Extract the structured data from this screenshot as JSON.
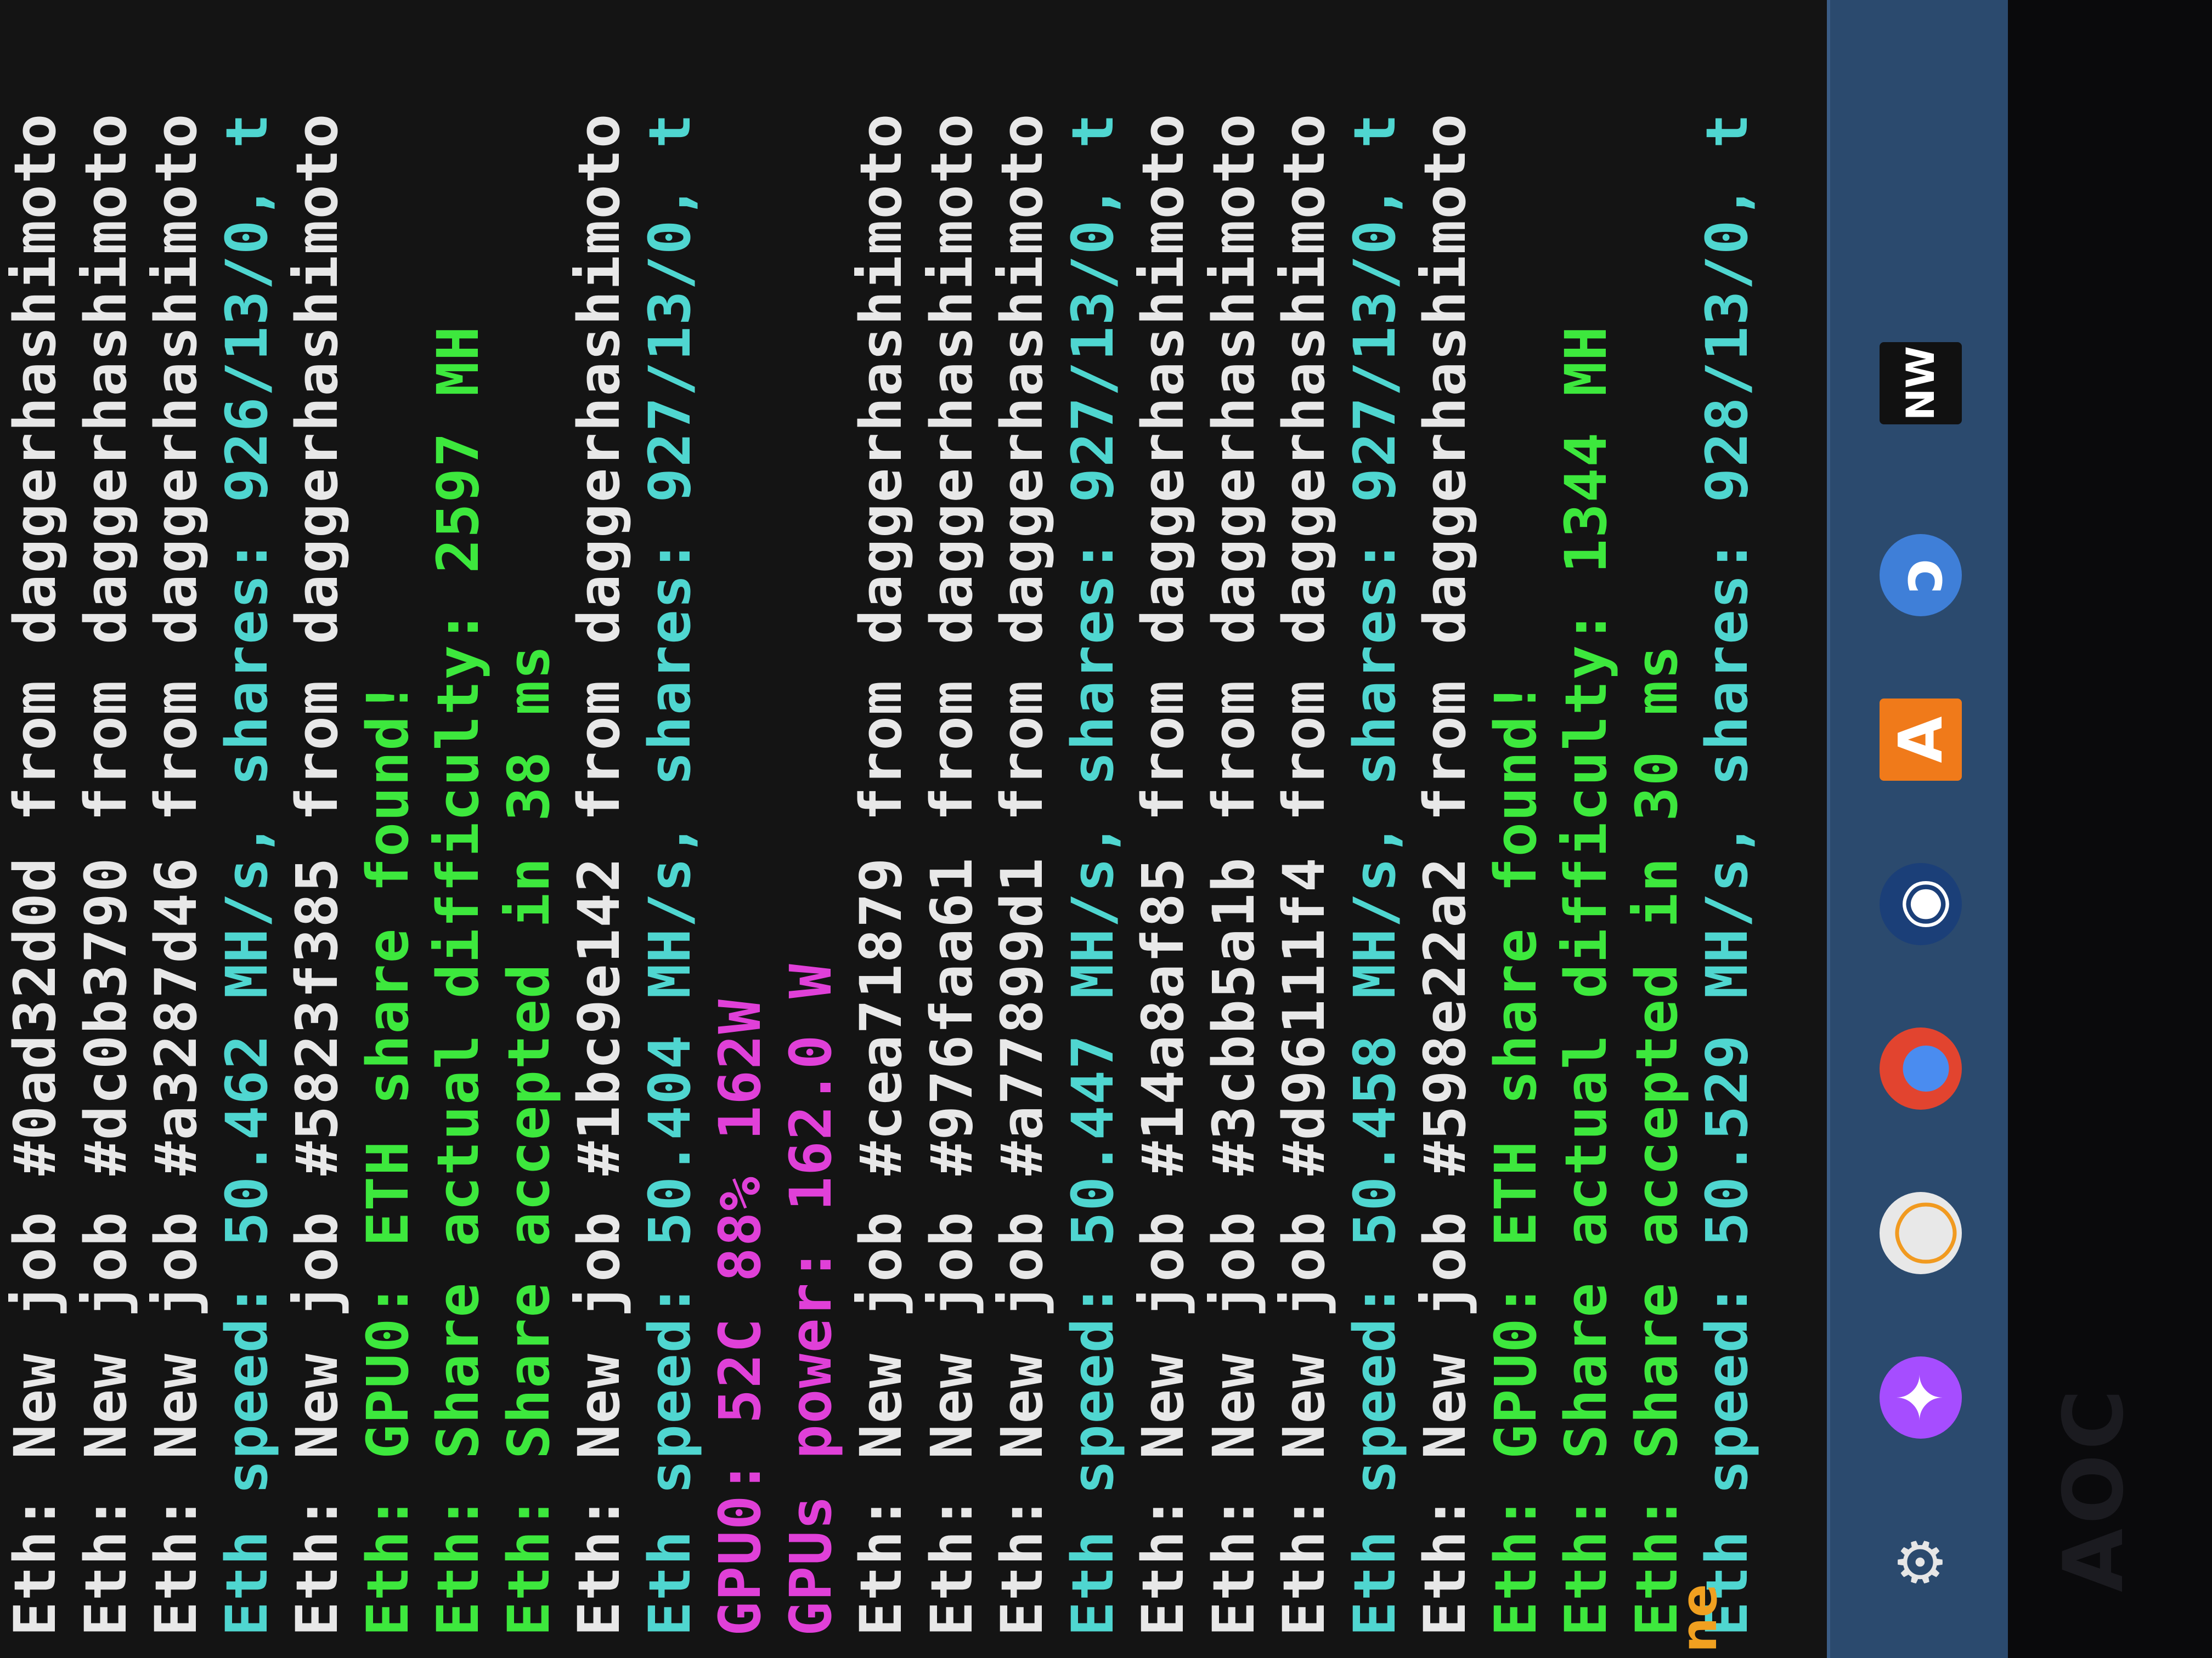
{
  "terminal": {
    "lines": [
      {
        "text": "Eth: New job #0ad32d0d from daggerhashimoto",
        "color": "white"
      },
      {
        "text": "Eth: New job #dc0b3790 from daggerhashimoto",
        "color": "white"
      },
      {
        "text": "Eth: New job #a3287d46 from daggerhashimoto",
        "color": "white"
      },
      {
        "text": "Eth speed: 50.462 MH/s, shares: 926/13/0, t",
        "color": "cyan"
      },
      {
        "text": "Eth: New job #5823f385 from daggerhashimoto",
        "color": "white"
      },
      {
        "text": "Eth: GPU0: ETH share found!",
        "color": "green"
      },
      {
        "text": "Eth: Share actual difficulty: 2597 MH",
        "color": "green"
      },
      {
        "text": "Eth: Share accepted in 38 ms",
        "color": "green"
      },
      {
        "text": "Eth: New job #1bc9e142 from daggerhashimoto",
        "color": "white"
      },
      {
        "text": "Eth speed: 50.404 MH/s, shares: 927/13/0, t",
        "color": "cyan"
      },
      {
        "text": "GPU0: 52C 88% 162W",
        "color": "magenta"
      },
      {
        "text": "GPUs power: 162.0 W",
        "color": "magenta"
      },
      {
        "text": "Eth: New job #cea71879 from daggerhashimoto",
        "color": "white"
      },
      {
        "text": "Eth: New job #976faa61 from daggerhashimoto",
        "color": "white"
      },
      {
        "text": "Eth: New job #a77899d1 from daggerhashimoto",
        "color": "white"
      },
      {
        "text": "Eth speed: 50.447 MH/s, shares: 927/13/0, t",
        "color": "cyan"
      },
      {
        "text": "Eth: New job #14a8af85 from daggerhashimoto",
        "color": "white"
      },
      {
        "text": "Eth: New job #3cbb5a1b from daggerhashimoto",
        "color": "white"
      },
      {
        "text": "Eth: New job #d96111f4 from daggerhashimoto",
        "color": "white"
      },
      {
        "text": "Eth speed: 50.458 MH/s, shares: 927/13/0, t",
        "color": "cyan"
      },
      {
        "text": "Eth: New job #598e22a2 from daggerhashimoto",
        "color": "white"
      },
      {
        "text": "Eth: GPU0: ETH share found!",
        "color": "green"
      },
      {
        "text": "Eth: Share actual difficulty: 1344 MH",
        "color": "green"
      },
      {
        "text": "Eth: Share accepted in 30 ms",
        "color": "green"
      },
      {
        "text": "Eth speed: 50.529 MH/s, shares: 928/13/0, t",
        "color": "cyan"
      }
    ]
  },
  "taskbar": {
    "icons": [
      {
        "name": "settings-gear-icon",
        "glyph": "⚙",
        "color": "#e6e6e6",
        "bg": "transparent"
      },
      {
        "name": "messenger-icon",
        "glyph": "✦",
        "color": "#ffffff",
        "bg": "#a64dff"
      },
      {
        "name": "overwatch-icon",
        "glyph": "◯",
        "color": "#f19a20",
        "bg": "#e8e8e8"
      },
      {
        "name": "chrome-icon",
        "glyph": "●",
        "color": "#4a8cf0",
        "bg": "#e2442f"
      },
      {
        "name": "steam-icon",
        "glyph": "◉",
        "color": "#ffffff",
        "bg": "#1b3f78"
      },
      {
        "name": "avast-icon",
        "glyph": "A",
        "color": "#ffffff",
        "bg": "#f07a1a"
      },
      {
        "name": "origin-icon",
        "glyph": "ↄ",
        "color": "#ffffff",
        "bg": "#3f7fd8"
      },
      {
        "name": "nicehash-icon",
        "glyph": "NW",
        "color": "#ffffff",
        "bg": "#111111"
      }
    ]
  },
  "bezel": {
    "brand": "AOC"
  },
  "side": {
    "text": "ne"
  }
}
